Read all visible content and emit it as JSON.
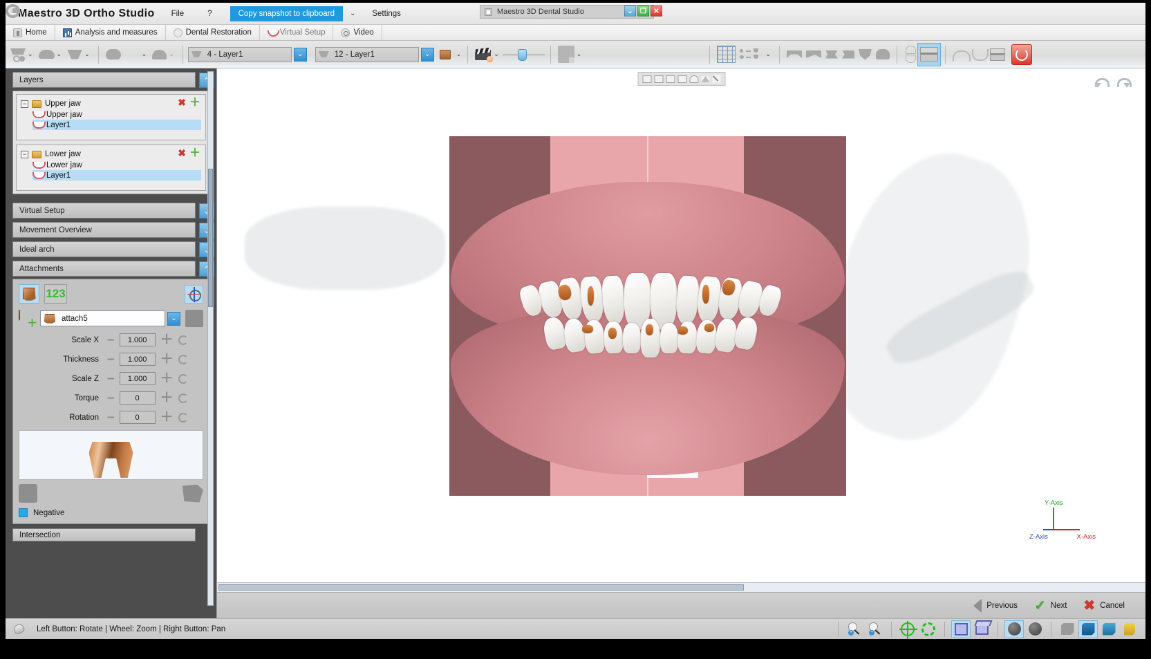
{
  "titlebar": {
    "app_title": "Maestro 3D Ortho Studio",
    "menu_file": "File",
    "menu_help": "?",
    "snapshot_button": "Copy snapshot to clipboard",
    "menu_settings": "Settings",
    "mdi_window_title": "Maestro 3D Dental Studio",
    "win_minimize": "⌄",
    "win_maximize": "❐",
    "win_close": "✕"
  },
  "tabs": [
    {
      "label": "Home",
      "icon": "home-icon",
      "active": false
    },
    {
      "label": "Analysis and measures",
      "icon": "chart-icon",
      "active": false
    },
    {
      "label": "Dental Restoration",
      "icon": "tooth-icon",
      "active": false
    },
    {
      "label": "Virtual Setup",
      "icon": "arch-icon",
      "active": true
    },
    {
      "label": "Video",
      "icon": "video-icon",
      "active": false
    }
  ],
  "toolbar": {
    "combo_upper": {
      "value": "4 - Layer1",
      "icon": "arch-icon"
    },
    "combo_lower": {
      "value": "12 - Layer1",
      "icon": "arch-icon"
    },
    "caret": "⌄",
    "power_button": "power-icon"
  },
  "left_panel": {
    "sections": [
      {
        "id": "layers",
        "title": "Layers",
        "expanded": true,
        "toggle": "⌃"
      },
      {
        "id": "virtual_setup",
        "title": "Virtual Setup",
        "expanded": false,
        "toggle": "⌄"
      },
      {
        "id": "movement_overview",
        "title": "Movement Overview",
        "expanded": false,
        "toggle": "⌄"
      },
      {
        "id": "ideal_arch",
        "title": "Ideal arch",
        "expanded": false,
        "toggle": "⌄"
      },
      {
        "id": "attachments",
        "title": "Attachments",
        "expanded": true,
        "toggle": "⌃"
      },
      {
        "id": "intersection",
        "title": "Intersection",
        "expanded": false,
        "toggle": "⌄"
      }
    ],
    "layers": [
      {
        "group": "Upper jaw",
        "expander": "−",
        "delete": "✖",
        "add": "＋",
        "children": [
          {
            "label": "Upper jaw",
            "selected": false
          },
          {
            "label": "Layer1",
            "selected": true
          }
        ]
      },
      {
        "group": "Lower jaw",
        "expander": "−",
        "delete": "✖",
        "add": "＋",
        "children": [
          {
            "label": "Lower jaw",
            "selected": false
          },
          {
            "label": "Layer1",
            "selected": true
          }
        ]
      }
    ],
    "attachments": {
      "number_badge": "123",
      "attachment_name": "attach5",
      "dropdown_caret": "⌄",
      "params": [
        {
          "label": "Scale X",
          "value": "1.000",
          "minus": "–",
          "plus": "＋"
        },
        {
          "label": "Thickness",
          "value": "1.000",
          "minus": "–",
          "plus": "＋"
        },
        {
          "label": "Scale Z",
          "value": "1.000",
          "minus": "–",
          "plus": "＋"
        },
        {
          "label": "Torque",
          "value": "0",
          "minus": "–",
          "plus": "＋"
        },
        {
          "label": "Rotation",
          "value": "0",
          "minus": "–",
          "plus": "＋"
        }
      ],
      "negative_label": "Negative",
      "negative_checked": true
    }
  },
  "viewport": {
    "axis": {
      "y": "Y-Axis",
      "z": "Z-Axis",
      "x": "X-Axis"
    },
    "undo": "undo-icon",
    "redo": "redo-icon"
  },
  "nav": {
    "previous": "Previous",
    "next": "Next",
    "cancel": "Cancel"
  },
  "statusbar": {
    "hint": "Left Button: Rotate | Wheel: Zoom | Right Button: Pan"
  },
  "colors": {
    "accent_blue": "#1f9ae0",
    "panel_dark": "#4d4d4d",
    "selection_blue": "#b6ddf5",
    "ok_green": "#3faa2c",
    "danger_red": "#d3362c",
    "attachment_orange": "#a9561f",
    "gum_pink": "#cf868d",
    "axis_y": "#17a117",
    "axis_z": "#2f4fc0",
    "axis_x": "#c02a2a"
  }
}
